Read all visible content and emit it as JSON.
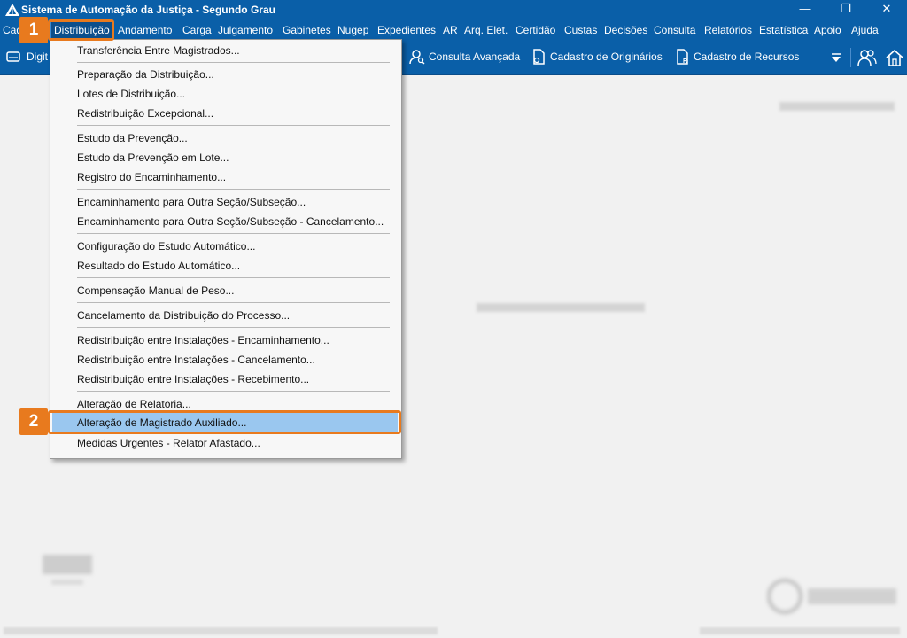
{
  "window": {
    "title": "Sistema de Automação da Justiça - Segundo Grau",
    "restore_glyph": "❐",
    "close_glyph": "✕",
    "minimize_glyph": "—"
  },
  "menubar": {
    "items": [
      {
        "label": "Cad"
      },
      {
        "label": "Distribuição",
        "active": true
      },
      {
        "label": "Andamento"
      },
      {
        "label": "Carga"
      },
      {
        "label": "Julgamento"
      },
      {
        "label": "Gabinetes"
      },
      {
        "label": "Nugep"
      },
      {
        "label": "Expedientes"
      },
      {
        "label": "AR"
      },
      {
        "label": "Arq. Elet."
      },
      {
        "label": "Certidão"
      },
      {
        "label": "Custas"
      },
      {
        "label": "Decisões"
      },
      {
        "label": "Consulta"
      },
      {
        "label": "Relatórios"
      },
      {
        "label": "Estatística"
      },
      {
        "label": "Apoio"
      },
      {
        "label": "Ajuda"
      }
    ]
  },
  "toolbar": {
    "digit_label": "Digit",
    "consulta_avancada": "Consulta Avançada",
    "cadastro_originarios": "Cadastro de Originários",
    "cadastro_recursos": "Cadastro de Recursos"
  },
  "dropdown": {
    "groups": [
      [
        "Transferência Entre Magistrados..."
      ],
      [
        "Preparação da Distribuição...",
        "Lotes de Distribuição...",
        "Redistribuição Excepcional..."
      ],
      [
        "Estudo da Prevenção...",
        "Estudo da Prevenção em Lote...",
        "Registro do Encaminhamento..."
      ],
      [
        "Encaminhamento para Outra Seção/Subseção...",
        "Encaminhamento para Outra Seção/Subseção - Cancelamento..."
      ],
      [
        "Configuração do Estudo Automático...",
        "Resultado do Estudo Automático..."
      ],
      [
        "Compensação Manual de Peso..."
      ],
      [
        "Cancelamento da Distribuição do Processo..."
      ],
      [
        "Redistribuição entre Instalações - Encaminhamento...",
        "Redistribuição entre Instalações - Cancelamento...",
        "Redistribuição entre Instalações - Recebimento..."
      ],
      [
        "Alteração de Relatoria...",
        "Alteração de Magistrado Auxiliado...",
        "Medidas Urgentes - Relator Afastado..."
      ]
    ],
    "highlighted": "Alteração de Magistrado Auxiliado..."
  },
  "callouts": {
    "step1": "1",
    "step2": "2"
  },
  "colors": {
    "menubar_bg": "#0a5fa8",
    "highlight": "#9ac7ef",
    "callout": "#e87a1e"
  }
}
